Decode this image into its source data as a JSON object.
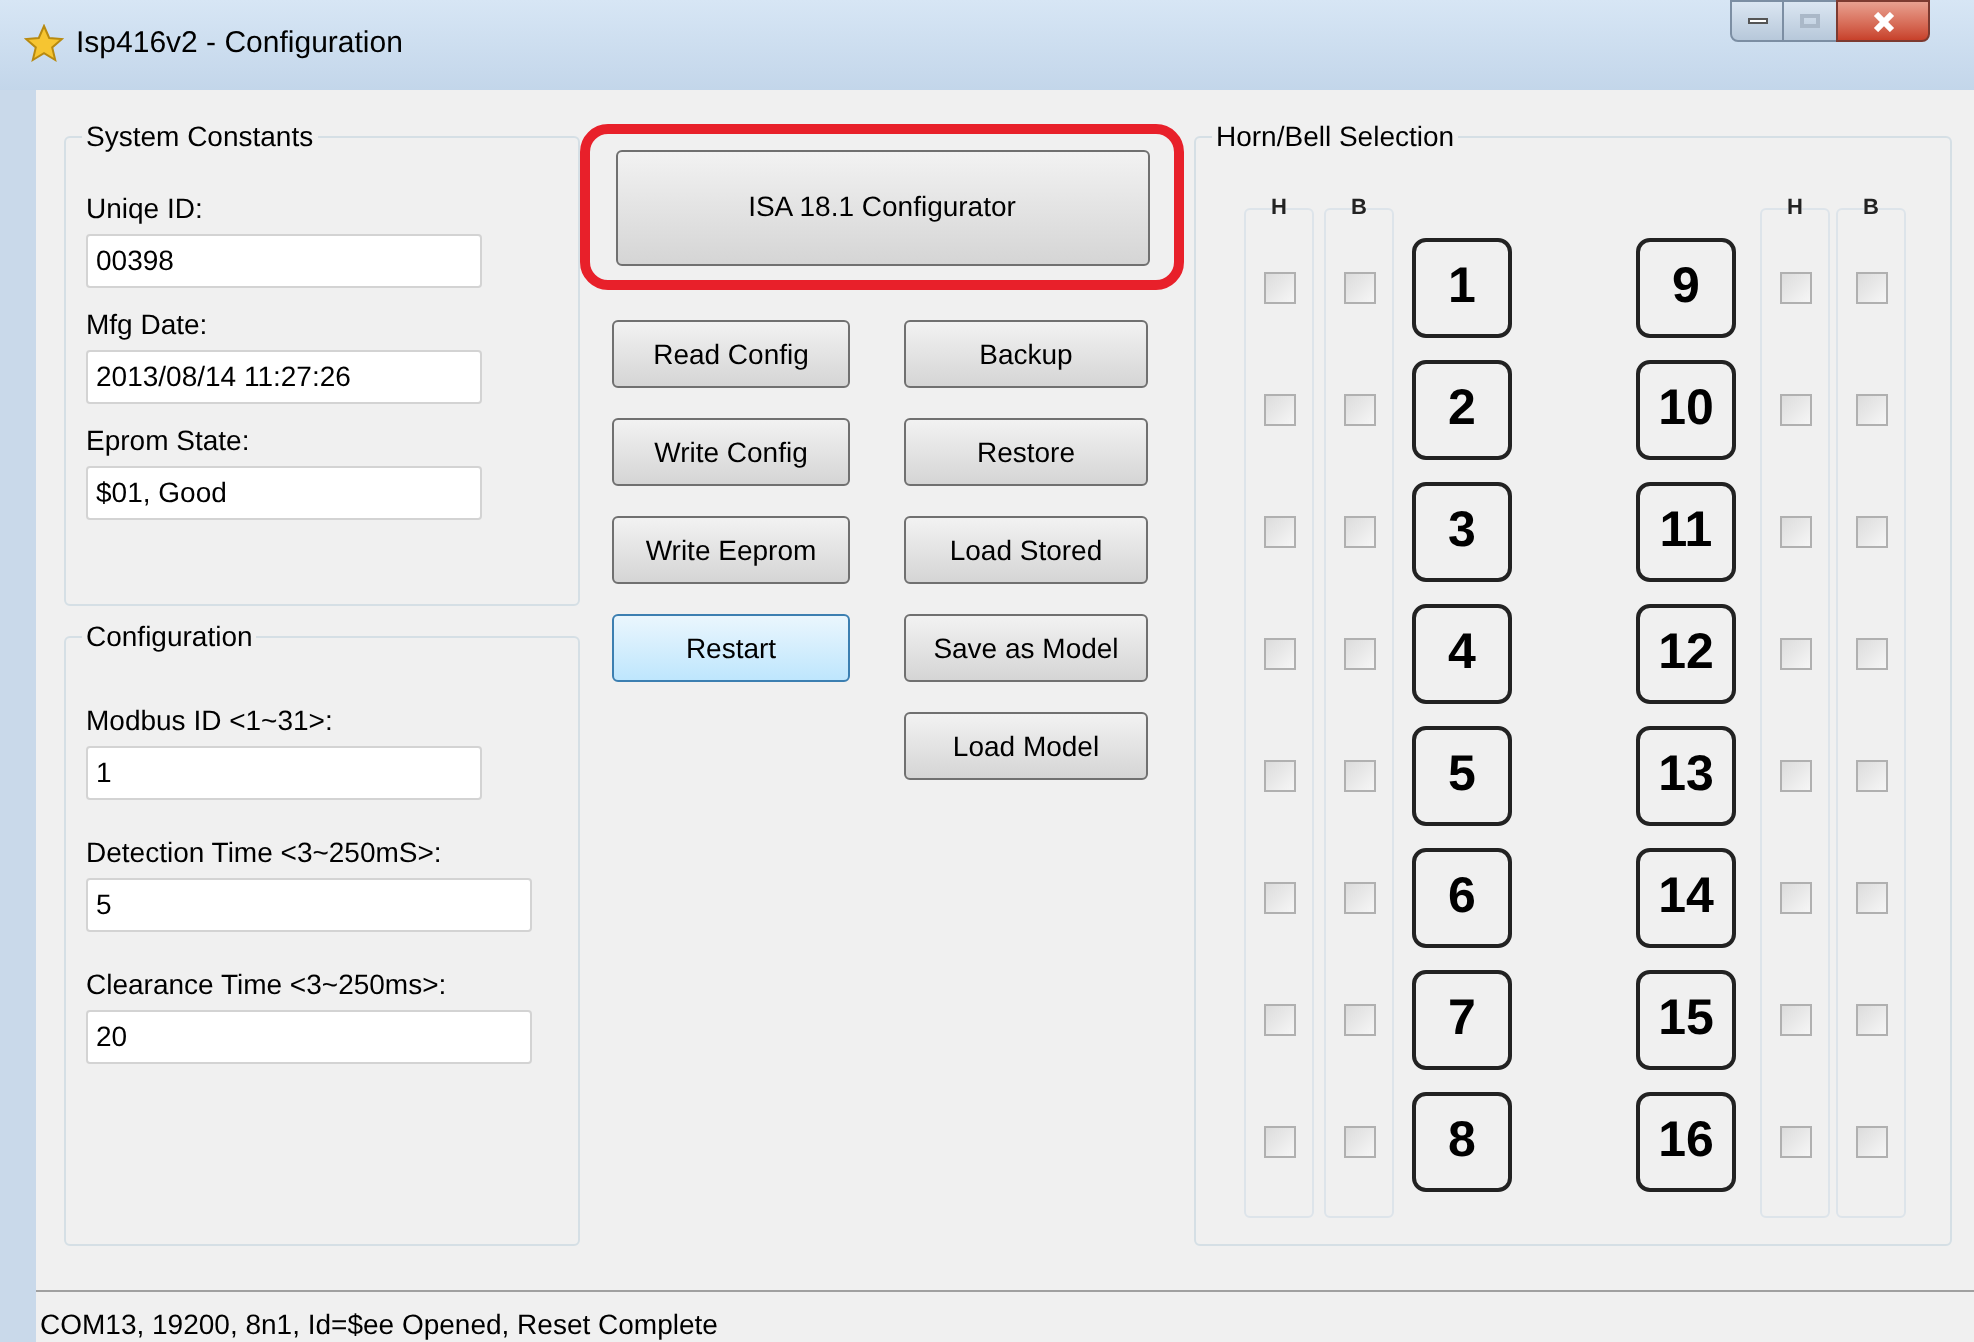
{
  "window": {
    "title": "Isp416v2 - Configuration"
  },
  "system_constants": {
    "title": "System Constants",
    "fields": [
      {
        "label": "Uniqe ID:",
        "value": "00398"
      },
      {
        "label": "Mfg Date:",
        "value": "2013/08/14 11:27:26"
      },
      {
        "label": "Eprom State:",
        "value": "$01, Good"
      }
    ]
  },
  "configuration": {
    "title": "Configuration",
    "fields": [
      {
        "label": "Modbus ID <1~31>:",
        "value": "1"
      },
      {
        "label": "Detection Time <3~250mS>:",
        "value": "5"
      },
      {
        "label": "Clearance Time <3~250ms>:",
        "value": "20"
      }
    ]
  },
  "configurator_button": {
    "label": "ISA 18.1 Configurator",
    "circled": true
  },
  "left_buttons": [
    {
      "label": "Read Config",
      "focused": false
    },
    {
      "label": "Write Config",
      "focused": false
    },
    {
      "label": "Write Eeprom",
      "focused": false
    },
    {
      "label": "Restart",
      "focused": true
    }
  ],
  "right_buttons": [
    {
      "label": "Backup",
      "focused": false
    },
    {
      "label": "Restore",
      "focused": false
    },
    {
      "label": "Load Stored",
      "focused": false
    },
    {
      "label": "Save as Model",
      "focused": false
    },
    {
      "label": "Load Model",
      "focused": false
    }
  ],
  "horn_bell": {
    "title": "Horn/Bell Selection",
    "left_headers": [
      "H",
      "B"
    ],
    "right_headers": [
      "H",
      "B"
    ],
    "channels": [
      {
        "number": "1",
        "horn": false,
        "bell": false
      },
      {
        "number": "2",
        "horn": false,
        "bell": false
      },
      {
        "number": "3",
        "horn": false,
        "bell": false
      },
      {
        "number": "4",
        "horn": false,
        "bell": false
      },
      {
        "number": "5",
        "horn": false,
        "bell": false
      },
      {
        "number": "6",
        "horn": false,
        "bell": false
      },
      {
        "number": "7",
        "horn": false,
        "bell": false
      },
      {
        "number": "8",
        "horn": false,
        "bell": false
      },
      {
        "number": "9",
        "horn": false,
        "bell": false
      },
      {
        "number": "10",
        "horn": false,
        "bell": false
      },
      {
        "number": "11",
        "horn": false,
        "bell": false
      },
      {
        "number": "12",
        "horn": false,
        "bell": false
      },
      {
        "number": "13",
        "horn": false,
        "bell": false
      },
      {
        "number": "14",
        "horn": false,
        "bell": false
      },
      {
        "number": "15",
        "horn": false,
        "bell": false
      },
      {
        "number": "16",
        "horn": false,
        "bell": false
      }
    ]
  },
  "status_bar": {
    "text": "COM13, 19200, 8n1, Id=$ee Opened, Reset Complete"
  }
}
